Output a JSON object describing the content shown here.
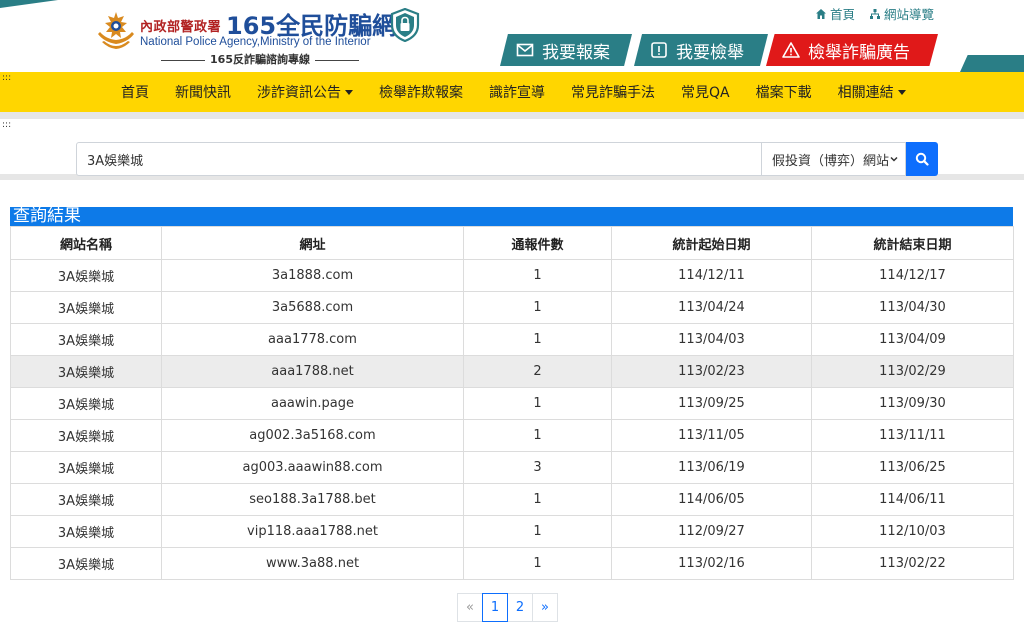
{
  "header": {
    "agency": "內政部警政署",
    "site_name": "165全民防騙網",
    "agency_en": "National Police Agency,Ministry of the Interior",
    "slogan": "165反詐騙諮詢專線",
    "top_links": [
      {
        "label": "首頁",
        "icon": "home-icon"
      },
      {
        "label": "網站導覽",
        "icon": "sitemap-icon"
      }
    ],
    "action_buttons": {
      "report": "我要報案",
      "tip": "我要檢舉",
      "ad": "檢舉詐騙廣告"
    },
    "colors": {
      "teal": "#2a7e86",
      "red": "#e01919",
      "nav": "#ffd600",
      "primary": "#0d6efd"
    }
  },
  "nav": {
    "items": [
      {
        "label": "首頁",
        "dropdown": false
      },
      {
        "label": "新聞快訊",
        "dropdown": false
      },
      {
        "label": "涉詐資訊公告",
        "dropdown": true
      },
      {
        "label": "檢舉詐欺報案",
        "dropdown": false
      },
      {
        "label": "識詐宣導",
        "dropdown": false
      },
      {
        "label": "常見詐騙手法",
        "dropdown": false
      },
      {
        "label": "常見QA",
        "dropdown": false
      },
      {
        "label": "檔案下載",
        "dropdown": false
      },
      {
        "label": "相關連結",
        "dropdown": true
      }
    ]
  },
  "search": {
    "value": "3A娛樂城",
    "category": "假投資（博弈）網站"
  },
  "results": {
    "title": "查詢結果",
    "columns": [
      "網站名稱",
      "網址",
      "通報件數",
      "統計起始日期",
      "統計結束日期"
    ],
    "rows": [
      [
        "3A娛樂城",
        "3a1888.com",
        "1",
        "114/12/11",
        "114/12/17"
      ],
      [
        "3A娛樂城",
        "3a5688.com",
        "1",
        "113/04/24",
        "113/04/30"
      ],
      [
        "3A娛樂城",
        "aaa1778.com",
        "1",
        "113/04/03",
        "113/04/09"
      ],
      [
        "3A娛樂城",
        "aaa1788.net",
        "2",
        "113/02/23",
        "113/02/29"
      ],
      [
        "3A娛樂城",
        "aaawin.page",
        "1",
        "113/09/25",
        "113/09/30"
      ],
      [
        "3A娛樂城",
        "ag002.3a5168.com",
        "1",
        "113/11/05",
        "113/11/11"
      ],
      [
        "3A娛樂城",
        "ag003.aaawin88.com",
        "3",
        "113/06/19",
        "113/06/25"
      ],
      [
        "3A娛樂城",
        "seo188.3a1788.bet",
        "1",
        "114/06/05",
        "114/06/11"
      ],
      [
        "3A娛樂城",
        "vip118.aaa1788.net",
        "1",
        "112/09/27",
        "112/10/03"
      ],
      [
        "3A娛樂城",
        "www.3a88.net",
        "1",
        "113/02/16",
        "113/02/22"
      ]
    ],
    "highlighted_row": 3
  },
  "pagination": {
    "prev": "«",
    "pages": [
      "1",
      "2"
    ],
    "current": "1",
    "next": "»"
  }
}
